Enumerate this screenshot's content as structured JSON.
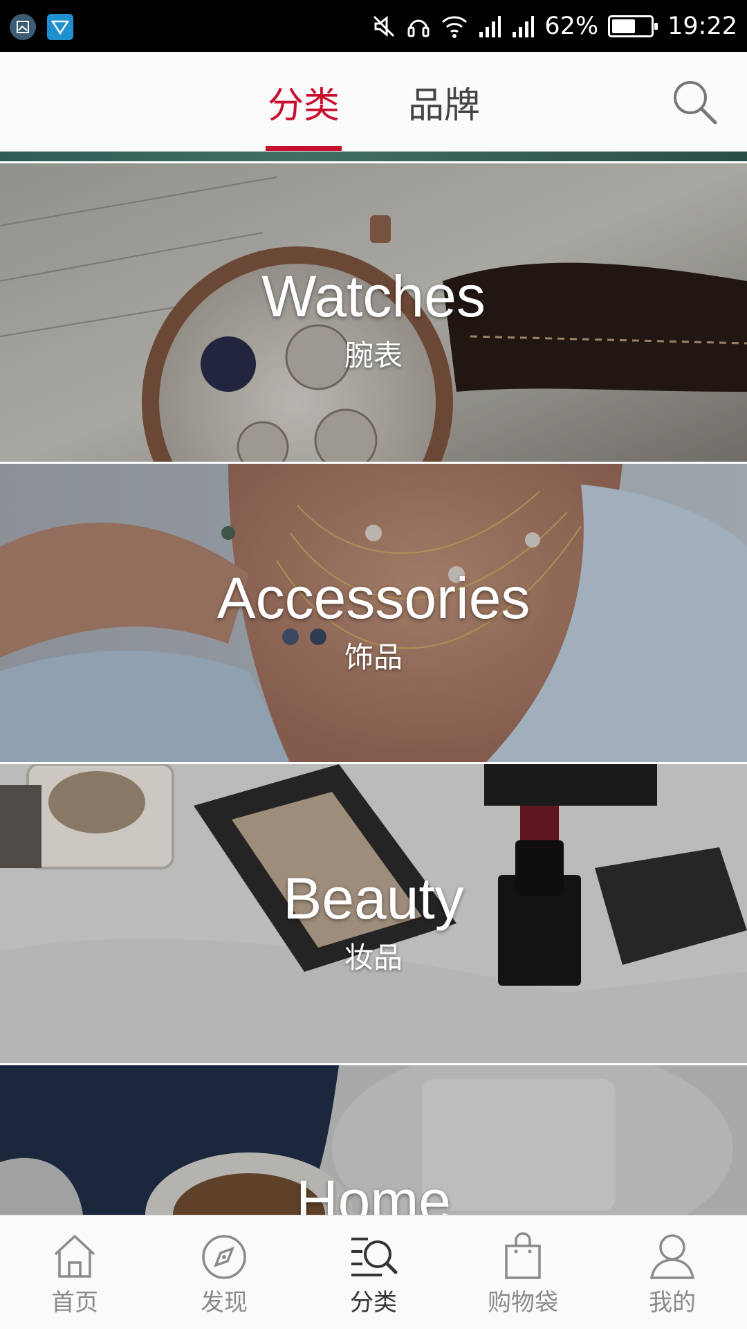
{
  "status_bar": {
    "battery": "62%",
    "battery_level": 0.62,
    "time": "19:22",
    "icons": [
      "gallery-app-icon",
      "vpn-app-icon",
      "silent-icon",
      "headset-icon",
      "wifi-icon",
      "signal-icon",
      "signal-icon"
    ]
  },
  "header": {
    "tabs": [
      {
        "label": "分类",
        "active": true
      },
      {
        "label": "品牌",
        "active": false
      }
    ],
    "search_icon": "search-icon",
    "accent_color": "#c8102e"
  },
  "categories": [
    {
      "title": "Watches",
      "subtitle": "腕表"
    },
    {
      "title": "Accessories",
      "subtitle": "饰品"
    },
    {
      "title": "Beauty",
      "subtitle": "妆品"
    },
    {
      "title": "Home",
      "subtitle": ""
    }
  ],
  "bottom_nav": [
    {
      "label": "首页",
      "icon": "home-icon",
      "active": false
    },
    {
      "label": "发现",
      "icon": "compass-icon",
      "active": false
    },
    {
      "label": "分类",
      "icon": "category-search-icon",
      "active": true
    },
    {
      "label": "购物袋",
      "icon": "shopping-bag-icon",
      "active": false
    },
    {
      "label": "我的",
      "icon": "profile-icon",
      "active": false
    }
  ]
}
